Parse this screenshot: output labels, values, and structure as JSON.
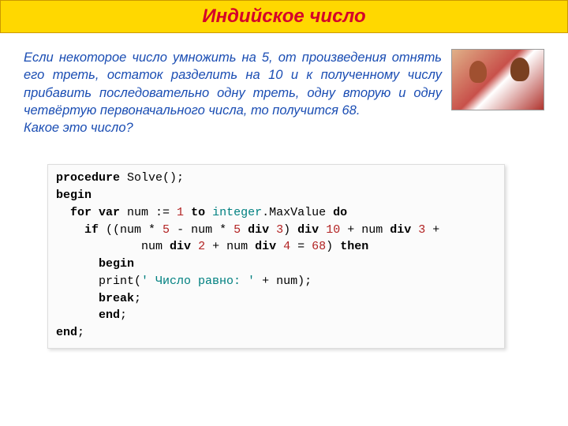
{
  "title": "Индийское число",
  "problem": {
    "body": "Если некоторое число умножить на 5, от произведения отнять его треть, остаток разделить на 10 и к полученному числу прибавить последовательно одну треть, одну вторую и одну четвёртую первоначального числа, то получится 68.",
    "question": "Какое это число?"
  },
  "code": {
    "l1a": "procedure",
    "l1b": " Solve();",
    "l2": "begin",
    "l3a": "  ",
    "l3b": "for var",
    "l3c": " num := ",
    "l3d": "1",
    "l3e": " ",
    "l3f": "to",
    "l3g": " ",
    "l3h": "integer",
    "l3i": ".MaxValue ",
    "l3j": "do",
    "l4a": "    ",
    "l4b": "if",
    "l4c": " ((num * ",
    "l4d": "5",
    "l4e": " - num * ",
    "l4f": "5",
    "l4g": " ",
    "l4h": "div",
    "l4i": " ",
    "l4j": "3",
    "l4k": ") ",
    "l4l": "div",
    "l4m": " ",
    "l4n": "10",
    "l4o": " + num ",
    "l4p": "div",
    "l4q": " ",
    "l4r": "3",
    "l4s": " +",
    "l5a": "            num ",
    "l5b": "div",
    "l5c": " ",
    "l5d": "2",
    "l5e": " + num ",
    "l5f": "div",
    "l5g": " ",
    "l5h": "4",
    "l5i": " = ",
    "l5j": "68",
    "l5k": ") ",
    "l5l": "then",
    "l6a": "      ",
    "l6b": "begin",
    "l7a": "      print(",
    "l7b": "' Число равно: '",
    "l7c": " + num);",
    "l8a": "      ",
    "l8b": "break",
    "l8c": ";",
    "l9a": "      ",
    "l9b": "end",
    "l9c": ";",
    "l10a": "end",
    "l10b": ";"
  }
}
